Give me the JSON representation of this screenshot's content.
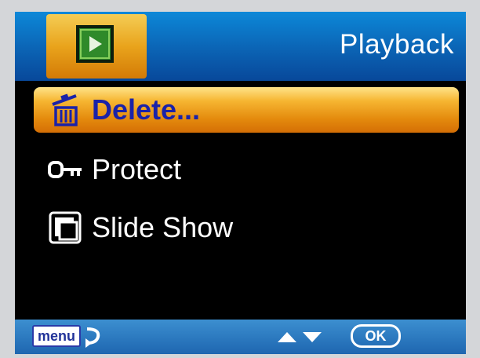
{
  "header": {
    "mode_icon": "play-icon",
    "title": "Playback"
  },
  "menu": {
    "items": [
      {
        "label": "Delete...",
        "icon": "trash-icon",
        "selected": true
      },
      {
        "label": "Protect",
        "icon": "key-icon",
        "selected": false
      },
      {
        "label": "Slide Show",
        "icon": "slideshow-icon",
        "selected": false
      }
    ]
  },
  "footer": {
    "menu_label": "menu",
    "back_icon": "return-arrow-icon",
    "nav_icon": "up-down-arrows-icon",
    "ok_label": "OK"
  },
  "colors": {
    "header_blue": "#0b63b4",
    "highlight_orange": "#e9a41c",
    "selected_text": "#1a22a8",
    "background": "#000000"
  }
}
